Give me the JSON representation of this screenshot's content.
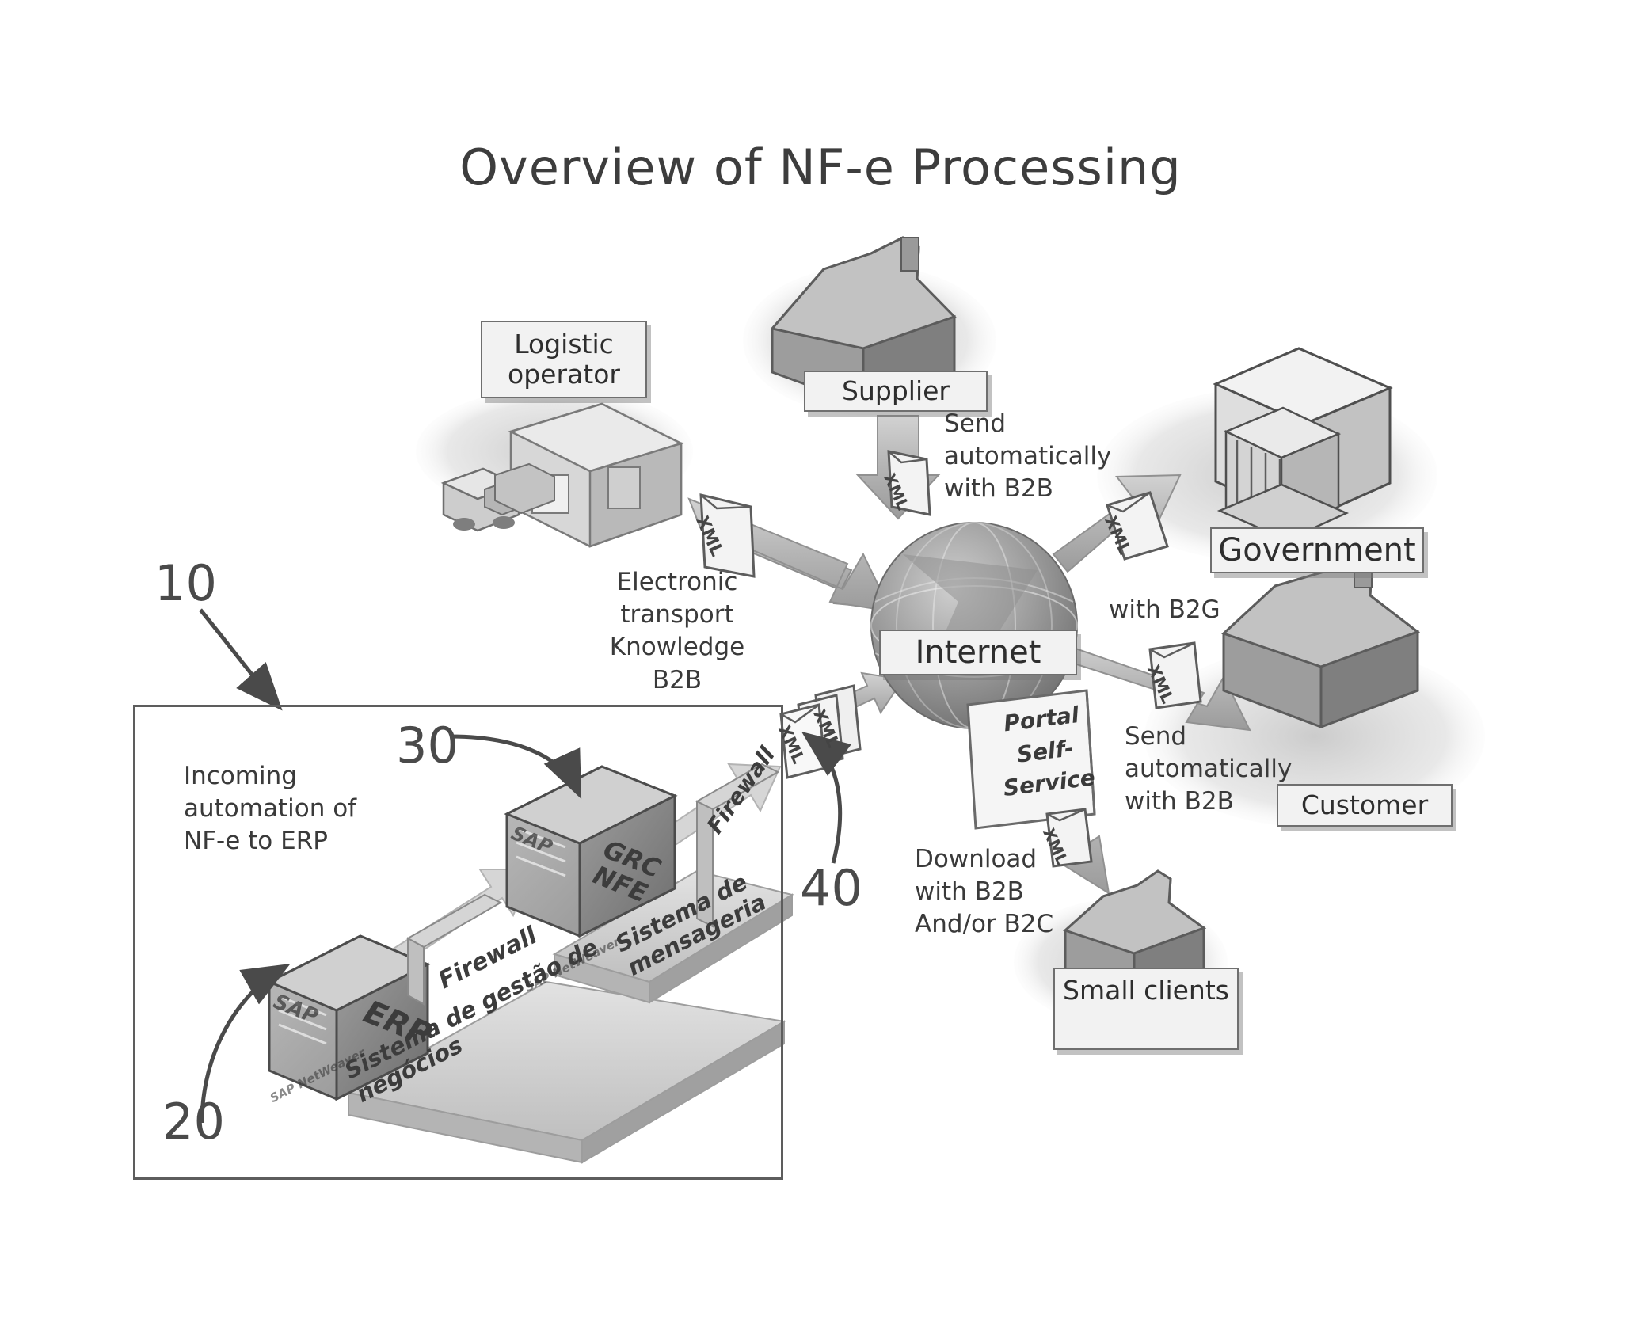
{
  "page": {
    "title": "Overview of NF-e Processing"
  },
  "reference_numerals": {
    "enclosure": "10",
    "erp_server": "20",
    "grc_server": "30",
    "xml_stack": "40"
  },
  "nodes": {
    "logistic_operator": "Logistic\noperator",
    "supplier": "Supplier",
    "internet": "Internet",
    "government": "Government",
    "customer": "Customer",
    "small_clients": "Small clients",
    "portal": "Portal\nSelf-Service"
  },
  "annotations": {
    "electronic_transport": "Electronic\ntransport\nKnowledge\nB2B",
    "send_b2b_supplier": "Send\nautomatically\nwith B2B",
    "with_b2g": "with B2G",
    "send_b2b_customer": "Send\nautomatically\nwith B2B",
    "download_b2b_b2c": "Download\nwith B2B\nAnd/or B2C",
    "incoming_automation": "Incoming\nautomation of\nNF-e to ERP"
  },
  "objects": {
    "erp_label": "ERP",
    "erp_vendor": "SAP",
    "erp_platform": "Sistema de gestão de\nnegócios",
    "erp_platform_vendor": "SAP NetWeaver",
    "grc_label": "GRC\nNFE",
    "grc_vendor": "SAP",
    "grc_platform": "Sistema de\nmensageria",
    "grc_platform_vendor": "SAP NetWeaver",
    "firewall_left": "Firewall",
    "firewall_right": "Firewall"
  },
  "icons": {
    "xml_doc": "XML",
    "factory": "factory-icon",
    "globe": "globe-icon",
    "government_building": "government-building-icon",
    "truck": "truck-icon",
    "warehouse": "warehouse-icon",
    "server": "server-icon",
    "document_stack": "document-stack-icon"
  },
  "colors": {
    "ink": "#3a3a3a",
    "plate_fill": "#f2f2f2",
    "plate_border": "#6f6f6f",
    "arrow_fill": "#b9b9b9",
    "arrow_stroke": "#8d8d8d",
    "shade_dark": "#8c8c8c",
    "shade_mid": "#a8a8a8",
    "shade_light": "#cfcfcf"
  }
}
